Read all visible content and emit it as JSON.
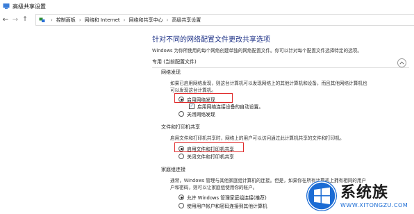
{
  "window": {
    "title": "高级共享设置"
  },
  "address_bar": {
    "crumbs": [
      "控制面板",
      "网络和 Internet",
      "网络和共享中心",
      "高级共享设置"
    ]
  },
  "main": {
    "heading": "针对不同的网络配置文件更改共享选项",
    "description": "Windows 为你所使用的每个网络创建单独的网络配置文件。你可以针对每个配置文件选择特定的选项。",
    "profile_section": {
      "label": "专用 (当前配置文件)"
    },
    "network_discovery": {
      "title": "网络发现",
      "description_line1": "如果已启用网络发现，则这台计算机可以发现网络上的其他计算机和设备，而且其他网络计算机也",
      "description_line2": "可以发现这台计算机。",
      "option_on": "启用网络发现",
      "auto_setup_checkbox": "启用网络连接设备的自动设置。",
      "option_off": "关闭网络发现"
    },
    "file_printer_sharing": {
      "title": "文件和打印机共享",
      "description": "启用文件和打印机共享时，网络上的用户可以访问通过此计算机共享的文件和打印机。",
      "option_on": "启用文件和打印机共享",
      "option_off": "关闭文件和打印机共享"
    },
    "homegroup": {
      "title": "家庭组连接",
      "description_line1": "通常，Windows 管理与其他家庭组计算机的连接。但是，如果你在所有计算机上拥有相同的用户",
      "description_line2": "户和密码，则可以让家庭组使用你的帐户。",
      "option_windows": "允许 Windows 管理家庭组连接(推荐)",
      "option_accounts": "使用用户帐户和密码连接到其他计算机"
    }
  },
  "watermark": {
    "title": "系统族",
    "url": "WWW.XITONGZU.COM"
  },
  "colors": {
    "heading_blue": "#1e3287",
    "highlight_red": "#e02a2a",
    "watermark_blue": "#1b6cd4"
  }
}
